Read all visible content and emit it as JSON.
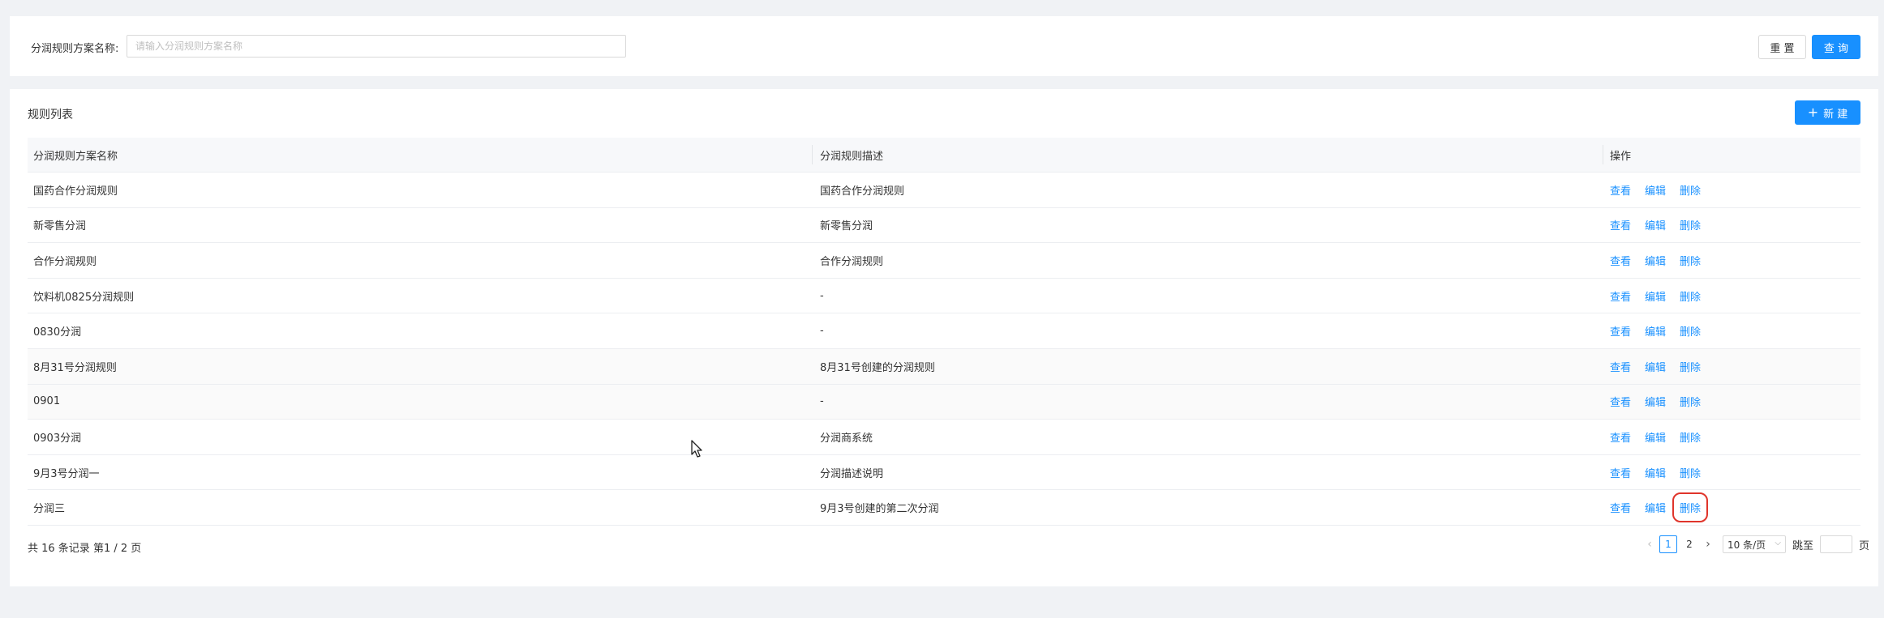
{
  "search": {
    "label": "分润规则方案名称:",
    "placeholder": "请输入分润规则方案名称",
    "reset_label": "重 置",
    "query_label": "查 询"
  },
  "list": {
    "title": "规则列表",
    "new_button": {
      "icon": "plus-icon",
      "label": "新 建"
    },
    "columns": [
      "分润规则方案名称",
      "分润规则描述",
      "操作"
    ],
    "row_actions": [
      "查看",
      "编辑",
      "删除"
    ],
    "rows": [
      {
        "name": "国药合作分润规则",
        "desc": "国药合作分润规则"
      },
      {
        "name": "新零售分润",
        "desc": "新零售分润"
      },
      {
        "name": "合作分润规则",
        "desc": "合作分润规则"
      },
      {
        "name": "饮料机0825分润规则",
        "desc": "-"
      },
      {
        "name": "0830分润",
        "desc": "-"
      },
      {
        "name": "8月31号分润规则",
        "desc": "8月31号创建的分润规则"
      },
      {
        "name": "0901",
        "desc": "-"
      },
      {
        "name": "0903分润",
        "desc": "分润商系统"
      },
      {
        "name": "9月3号分润一",
        "desc": "分润描述说明"
      },
      {
        "name": "分润三",
        "desc": "9月3号创建的第二次分润"
      }
    ]
  },
  "pagination": {
    "summary": "共 16 条记录 第1 / 2 页",
    "pages": [
      "1",
      "2"
    ],
    "current_page": "1",
    "page_size": "10 条/页",
    "jump_label": "跳至",
    "page_suffix": "页"
  },
  "colors": {
    "accent": "#1890ff",
    "highlight": "#e0352b",
    "background": "#f0f2f5"
  }
}
